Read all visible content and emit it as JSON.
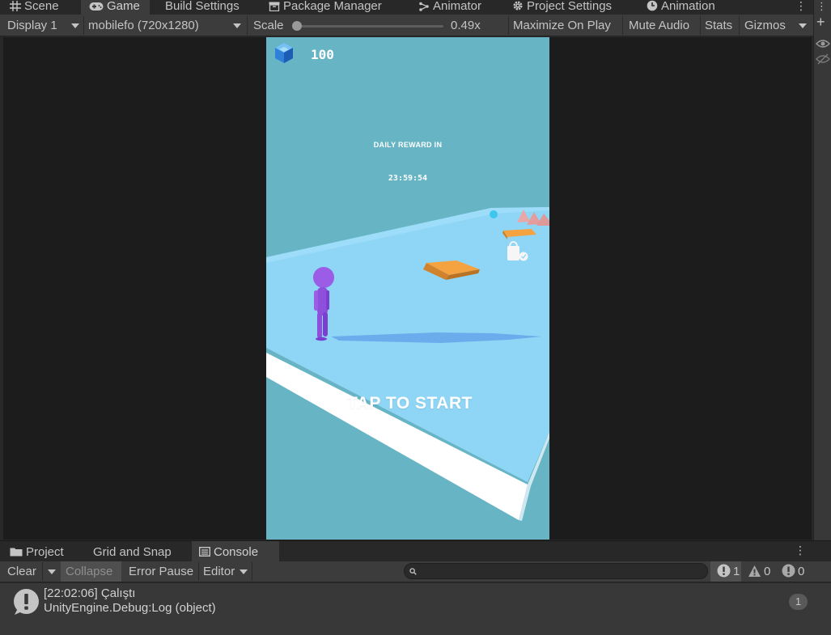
{
  "tabs": [
    {
      "label": "Scene",
      "icon": "grid-icon"
    },
    {
      "label": "Game",
      "icon": "gamepad-icon"
    },
    {
      "label": "Build Settings",
      "icon": ""
    },
    {
      "label": "Package Manager",
      "icon": "package-icon"
    },
    {
      "label": "Animator",
      "icon": "animator-icon"
    },
    {
      "label": "Project Settings",
      "icon": "gear-icon"
    },
    {
      "label": "Animation",
      "icon": "clock-icon"
    }
  ],
  "game_toolbar": {
    "display": "Display 1",
    "resolution": "mobilefo (720x1280)",
    "scale_label": "Scale",
    "scale_value": "0.49x",
    "scale_fraction": 0.0,
    "maximize": "Maximize On Play",
    "mute": "Mute Audio",
    "stats": "Stats",
    "gizmos": "Gizmos"
  },
  "game": {
    "coins": "100",
    "reward_title": "DAILY REWARD IN",
    "reward_time": "23:59:54",
    "tap_text": "TAP TO START",
    "colors": {
      "sky": "#66b4c4",
      "floor": "#8fd5f5",
      "character": "#9b5de5",
      "pad": "#f4a340"
    }
  },
  "bottom_tabs": [
    {
      "label": "Project",
      "icon": "folder-icon"
    },
    {
      "label": "Grid and Snap",
      "icon": ""
    },
    {
      "label": "Console",
      "icon": "console-icon"
    }
  ],
  "console_toolbar": {
    "clear": "Clear",
    "collapse": "Collapse",
    "error_pause": "Error Pause",
    "editor": "Editor",
    "search_placeholder": "",
    "log_count": "1",
    "warn_count": "0",
    "error_count": "0"
  },
  "logs": [
    {
      "line1": "[22:02:06] Çalıştı",
      "line2": "UnityEngine.Debug:Log (object)",
      "count": "1"
    }
  ]
}
